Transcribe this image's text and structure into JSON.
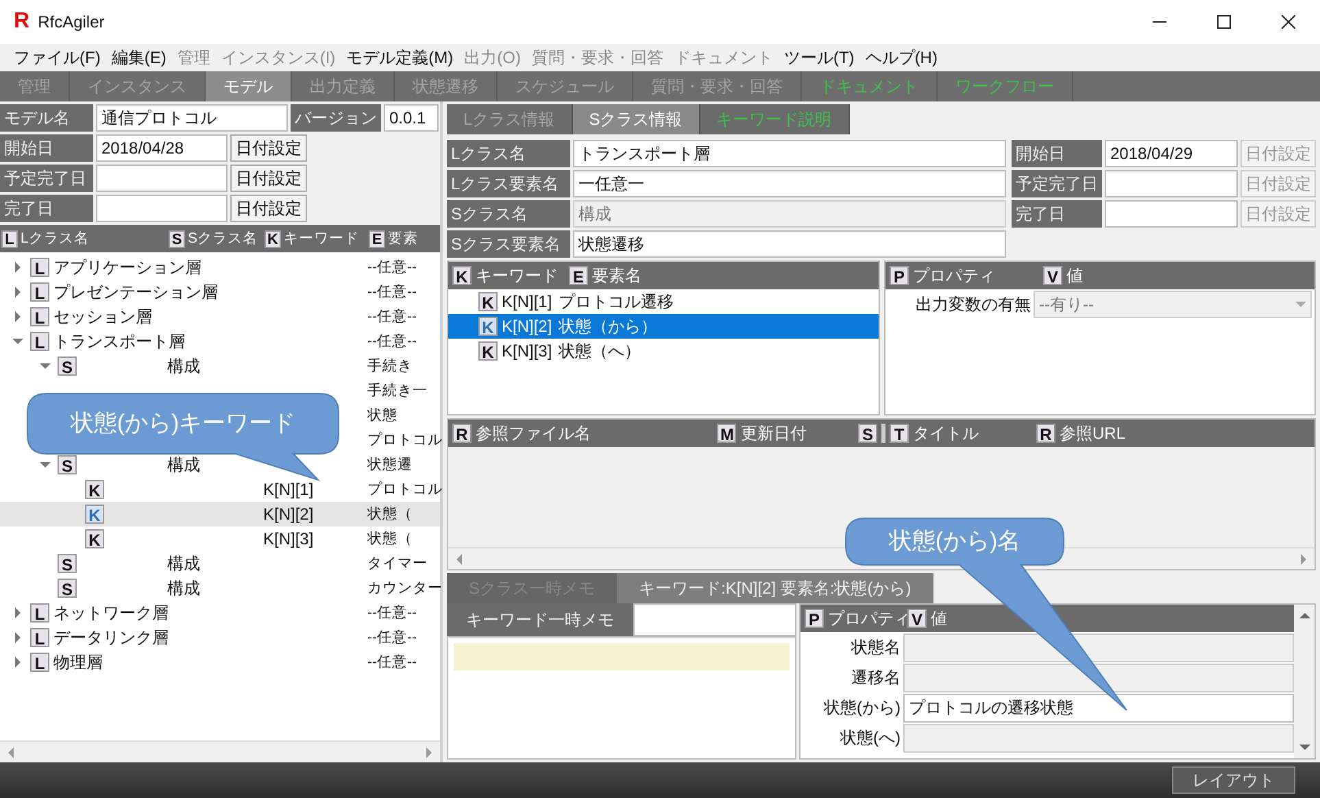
{
  "window": {
    "logo": "R",
    "title": "RfcAgiler"
  },
  "menu": [
    {
      "label": "ファイル(F)",
      "disabled": false
    },
    {
      "label": "編集(E)",
      "disabled": false
    },
    {
      "label": "管理",
      "disabled": true
    },
    {
      "label": "インスタンス(I)",
      "disabled": true
    },
    {
      "label": "モデル定義(M)",
      "disabled": false
    },
    {
      "label": "出力(O)",
      "disabled": true
    },
    {
      "label": "質問・要求・回答",
      "disabled": true
    },
    {
      "label": "ドキュメント",
      "disabled": true
    },
    {
      "label": "ツール(T)",
      "disabled": false
    },
    {
      "label": "ヘルプ(H)",
      "disabled": false
    }
  ],
  "main_tabs": [
    {
      "label": "管理",
      "selected": false,
      "kind": "normal"
    },
    {
      "label": "インスタンス",
      "selected": false,
      "kind": "normal"
    },
    {
      "label": "モデル",
      "selected": true,
      "kind": "normal"
    },
    {
      "label": "出力定義",
      "selected": false,
      "kind": "normal"
    },
    {
      "label": "状態遷移",
      "selected": false,
      "kind": "normal"
    },
    {
      "label": "スケジュール",
      "selected": false,
      "kind": "normal"
    },
    {
      "label": "質問・要求・回答",
      "selected": false,
      "kind": "normal"
    },
    {
      "label": "ドキュメント",
      "selected": false,
      "kind": "highlight"
    },
    {
      "label": "ワークフロー",
      "selected": false,
      "kind": "highlight"
    }
  ],
  "model": {
    "name_label": "モデル名",
    "name": "通信プロトコル",
    "version_label": "バージョン",
    "version": "0.0.1"
  },
  "model_dates": [
    {
      "label": "開始日",
      "value": "2018/04/28",
      "button": "日付設定",
      "disabled": false
    },
    {
      "label": "予定完了日",
      "button": "日付設定",
      "disabled": false
    },
    {
      "label": "完了日",
      "button": "日付設定",
      "disabled": false
    }
  ],
  "tree": {
    "columns": [
      {
        "icon": "L",
        "label": "Lクラス名"
      },
      {
        "icon": "S",
        "label": "Sクラス名"
      },
      {
        "icon": "K",
        "label": "キーワード"
      },
      {
        "icon": "E",
        "label": "要素"
      }
    ],
    "items": [
      {
        "icon": "L",
        "name": "アプリケーション層",
        "element": "--任意--",
        "expanded": false,
        "selected": false
      },
      {
        "icon": "L",
        "name": "プレゼンテーション層",
        "element": "--任意--",
        "expanded": false,
        "selected": false
      },
      {
        "icon": "L",
        "name": "セッション層",
        "element": "--任意--",
        "expanded": false,
        "selected": false
      },
      {
        "icon": "L",
        "name": "トランスポート層",
        "element": "--任意--",
        "expanded": true,
        "selected": false,
        "children": [
          {
            "icon": "S",
            "sclass": "構成",
            "element": "手続き",
            "expanded": true,
            "selected": false,
            "children": [
              {
                "element": "手続き一",
                "selected": false
              },
              {
                "element": "状態",
                "selected": false
              },
              {
                "element": "プロトコル",
                "selected": false
              }
            ]
          },
          {
            "icon": "S",
            "sclass": "構成",
            "element": "状態遷",
            "expanded": true,
            "selected": false,
            "children": [
              {
                "icon": "K",
                "keyword": "K[N][1]",
                "element": "プロトコル",
                "selected": false
              },
              {
                "icon": "K",
                "keyword": "K[N][2]",
                "element": "状態（",
                "selected": true
              },
              {
                "icon": "K",
                "keyword": "K[N][3]",
                "element": "状態（",
                "selected": false
              }
            ]
          },
          {
            "icon": "S",
            "sclass": "構成",
            "element": "タイマー",
            "selected": false
          },
          {
            "icon": "S",
            "sclass": "構成",
            "element": "カウンター",
            "selected": false
          }
        ]
      },
      {
        "icon": "L",
        "name": "ネットワーク層",
        "element": "--任意--",
        "expanded": false,
        "selected": false
      },
      {
        "icon": "L",
        "name": "データリンク層",
        "element": "--任意--",
        "expanded": false,
        "selected": false
      },
      {
        "icon": "L",
        "name": "物理層",
        "element": "--任意--",
        "expanded": false,
        "selected": false
      }
    ]
  },
  "class_tabs": [
    {
      "label": "Lクラス情報",
      "selected": false,
      "kind": "normal"
    },
    {
      "label": "Sクラス情報",
      "selected": true,
      "kind": "normal"
    },
    {
      "label": "キーワード説明",
      "selected": false,
      "kind": "highlight"
    }
  ],
  "class_fields": [
    {
      "label": "Lクラス名",
      "value": "トランスポート層",
      "disabled": false
    },
    {
      "label": "Lクラス要素名",
      "value": "一任意一",
      "disabled": false
    },
    {
      "label": "Sクラス名",
      "value": "構成",
      "disabled": true
    },
    {
      "label": "Sクラス要素名",
      "value": "状態遷移",
      "disabled": false
    }
  ],
  "class_dates": [
    {
      "label": "開始日",
      "value": "2018/04/29",
      "button": "日付設定",
      "disabled": true
    },
    {
      "label": "予定完了日",
      "button": "日付設定",
      "disabled": true
    },
    {
      "label": "完了日",
      "button": "日付設定",
      "disabled": true
    }
  ],
  "keywords": {
    "columns": [
      {
        "icon": "K",
        "label": "キーワード"
      },
      {
        "icon": "E",
        "label": "要素名"
      }
    ],
    "rows": [
      {
        "icon": "K",
        "keyword": "K[N][1]",
        "element": "プロトコル遷移",
        "selected": false
      },
      {
        "icon": "K",
        "keyword": "K[N][2]",
        "element": "状態（から）",
        "selected": true
      },
      {
        "icon": "K",
        "keyword": "K[N][3]",
        "element": "状態（へ）",
        "selected": false
      }
    ]
  },
  "properties": {
    "columns": [
      {
        "icon": "P",
        "label": "プロパティ"
      },
      {
        "icon": "V",
        "label": "値"
      }
    ],
    "rows": [
      {
        "label": "出力変数の有無",
        "value": "--有り--",
        "disabled": true
      }
    ]
  },
  "references": {
    "left_columns": [
      {
        "icon": "R",
        "label": "参照ファイル名"
      },
      {
        "icon": "M",
        "label": "更新日付"
      },
      {
        "icon": "S"
      }
    ],
    "right_columns": [
      {
        "icon": "T",
        "label": "タイトル"
      },
      {
        "icon": "R",
        "label": "参照URL"
      }
    ]
  },
  "memo_tabs": [
    {
      "label": "Sクラス一時メモ",
      "selected": false
    },
    {
      "label": "キーワード:K[N][2] 要素名:状態(から)",
      "selected": true
    }
  ],
  "memo": {
    "label": "キーワード一時メモ"
  },
  "keyword_properties": {
    "columns": [
      {
        "icon": "P",
        "label": "プロパティ"
      },
      {
        "icon": "V",
        "label": "値"
      }
    ],
    "rows": [
      {
        "label": "状態名",
        "disabled": true
      },
      {
        "label": "遷移名",
        "disabled": true
      },
      {
        "label": "状態(から)",
        "value": "プロトコルの遷移状態",
        "disabled": false
      },
      {
        "label": "状態(へ)",
        "disabled": true
      }
    ]
  },
  "status_bar": {
    "button": "レイアウト"
  },
  "callouts": [
    {
      "text": "状態(から)キーワード"
    },
    {
      "text": "状態(から)名"
    }
  ]
}
